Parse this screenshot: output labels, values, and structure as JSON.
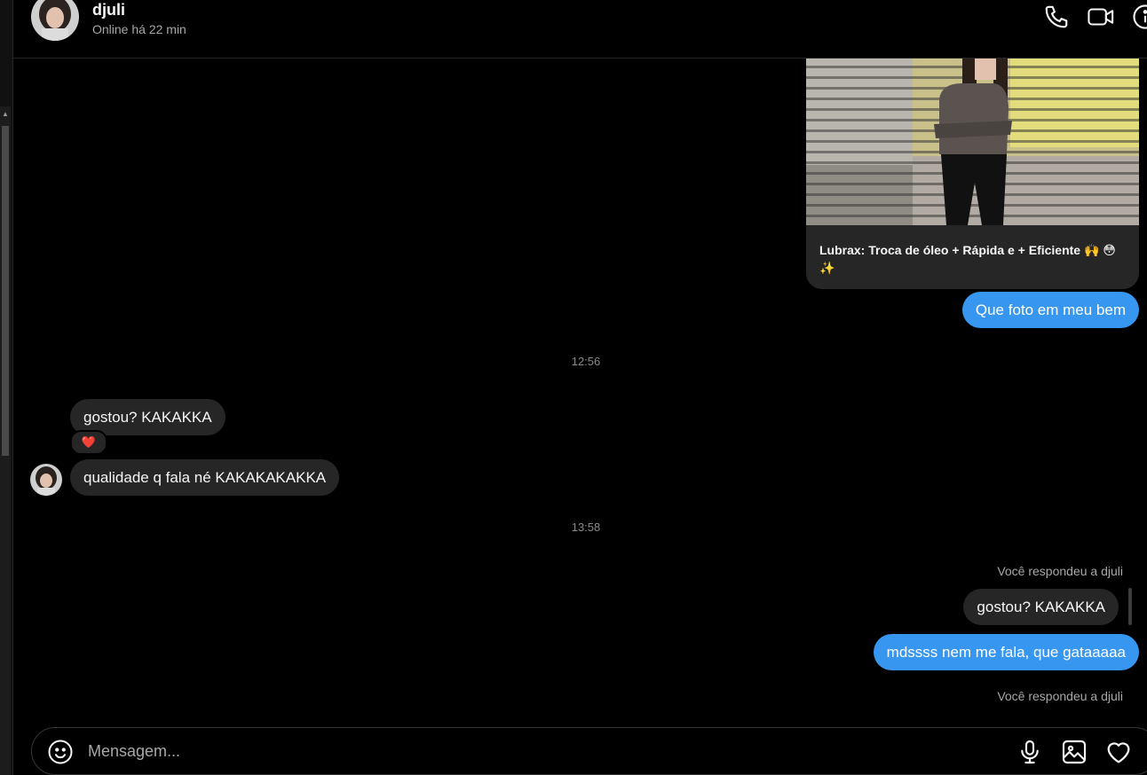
{
  "header": {
    "contact_name": "djuli",
    "status": "Online há 22 min",
    "actions": [
      "phone-icon",
      "video-call-icon",
      "info-icon"
    ]
  },
  "post": {
    "caption": "Lubrax: Troca de óleo + Rápida e + Eficiente 🙌 😳 ✨"
  },
  "messages": [
    {
      "from": "me",
      "text": "Que foto em meu bem"
    },
    {
      "type": "time",
      "text": "12:56"
    },
    {
      "from": "djuli",
      "text": "gostou? KAKAKKA",
      "reaction": "❤️"
    },
    {
      "from": "djuli",
      "text": "qualidade q fala né KAKAKAKAKKA"
    },
    {
      "type": "time",
      "text": "13:58"
    },
    {
      "type": "reply-note",
      "text": "Você respondeu a djuli"
    },
    {
      "type": "quoted",
      "text": "gostou? KAKAKKA"
    },
    {
      "from": "me",
      "text": "mdssss nem me fala, que gataaaaa"
    },
    {
      "type": "reply-note",
      "text": "Você respondeu a djuli"
    }
  ],
  "composer": {
    "placeholder": "Mensagem...",
    "actions": [
      "microphone-icon",
      "image-icon",
      "heart-icon"
    ]
  },
  "colors": {
    "background": "#000000",
    "incoming_bubble": "#262626",
    "outgoing_bubble": "#3797f0",
    "reaction_heart": "#ff3040"
  }
}
